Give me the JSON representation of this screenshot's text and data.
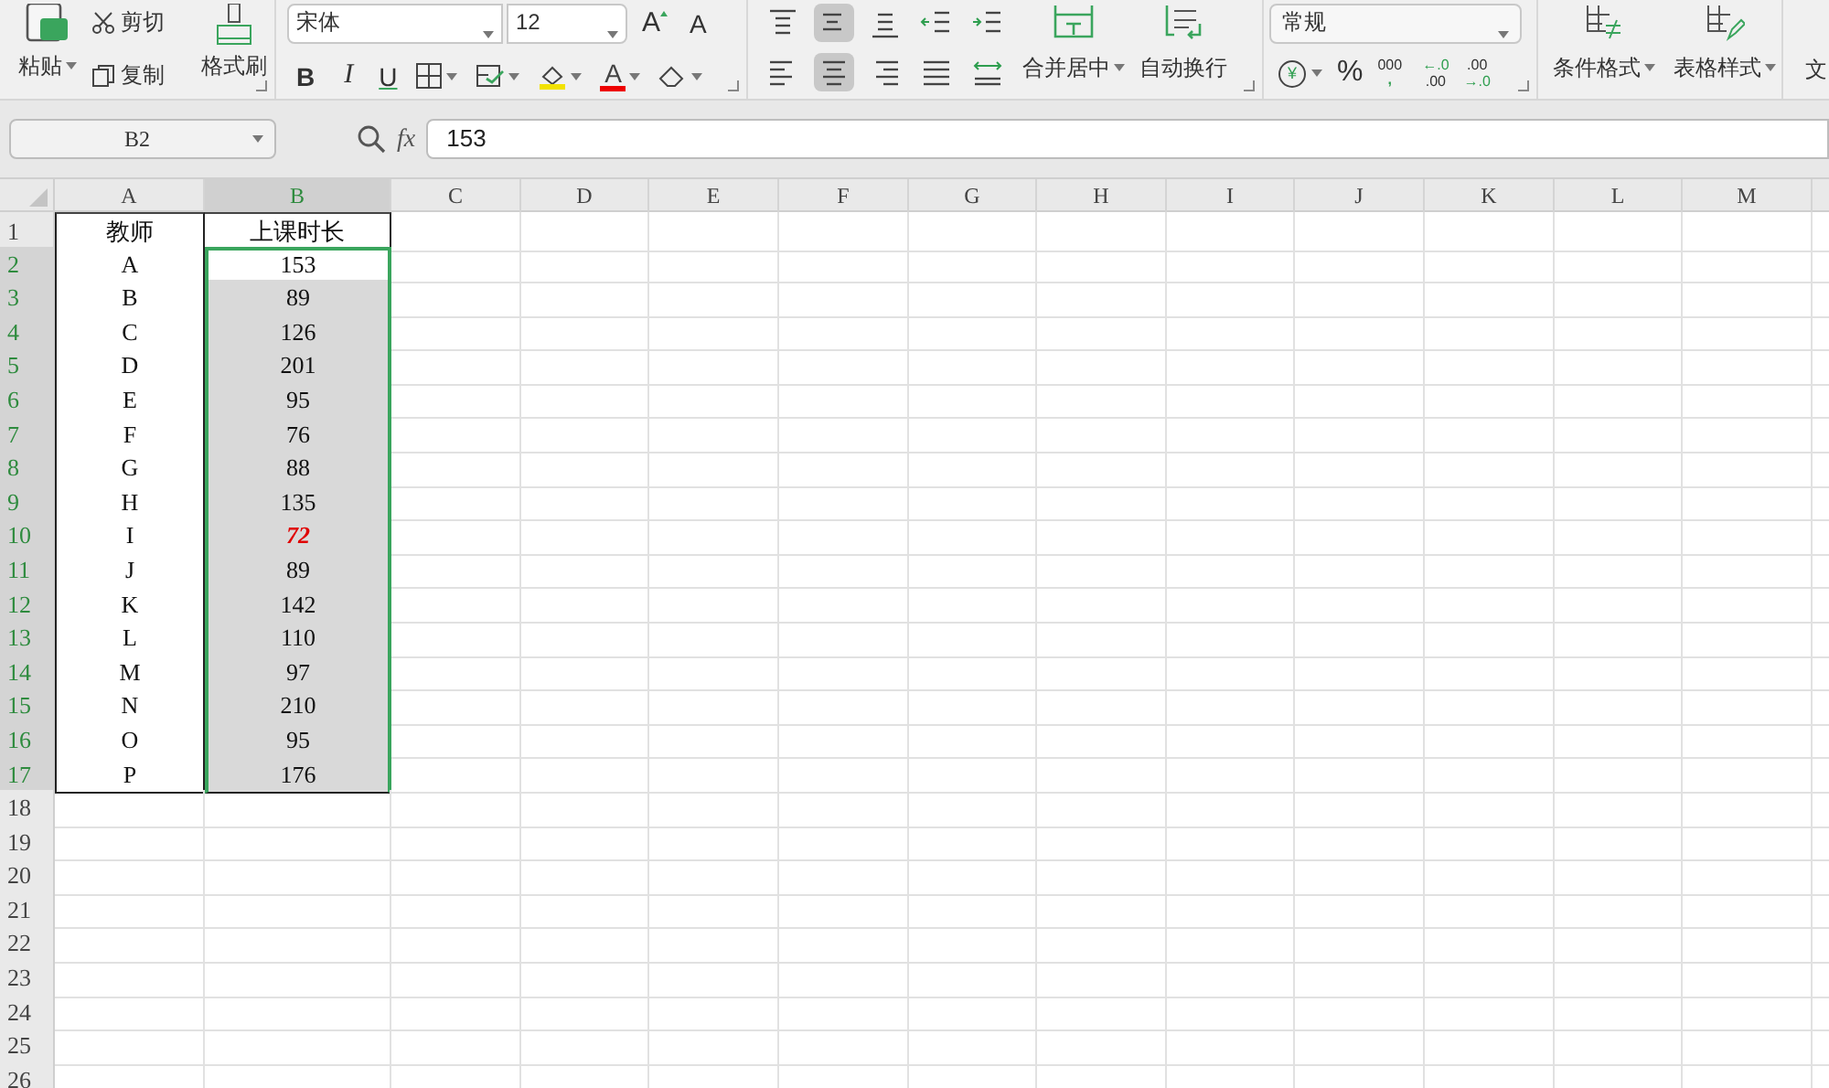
{
  "toolbar": {
    "clipboard": {
      "paste": "粘贴",
      "cut": "剪切",
      "copy": "复制",
      "format_painter": "格式刷"
    },
    "font": {
      "family": "宋体",
      "size": "12",
      "grow": "A",
      "shrink": "A",
      "bold": "B",
      "italic": "I",
      "underline": "U",
      "font_color": "A"
    },
    "align_top_row": [
      {
        "kind": "top",
        "selected": false
      },
      {
        "kind": "middle",
        "selected": true
      },
      {
        "kind": "bottom",
        "selected": false
      },
      {
        "kind": "outdent",
        "selected": false
      },
      {
        "kind": "indent",
        "selected": false
      }
    ],
    "align_bottom_row": [
      {
        "kind": "left",
        "selected": false
      },
      {
        "kind": "center",
        "selected": true
      },
      {
        "kind": "right",
        "selected": false
      },
      {
        "kind": "justify",
        "selected": false
      },
      {
        "kind": "distributed",
        "selected": false
      }
    ],
    "merge": "合并居中",
    "wrap": "自动换行",
    "number": {
      "format": "常规",
      "currency": "¥",
      "percent": "%",
      "thousands": [
        "000",
        ","
      ],
      "increase_decimal": [
        "←.0",
        ".00"
      ],
      "decrease_decimal": [
        ".00",
        "→.0"
      ]
    },
    "styles": [
      "条件格式",
      "表格样式"
    ],
    "cut_off": "文"
  },
  "formula_bar": {
    "name_box": "B2",
    "fx": "fx",
    "formula": "153"
  },
  "sheet": {
    "columns": [
      {
        "label": "A",
        "selected": false
      },
      {
        "label": "B",
        "selected": true
      },
      {
        "label": "C",
        "selected": false
      },
      {
        "label": "D",
        "selected": false
      },
      {
        "label": "E",
        "selected": false
      },
      {
        "label": "F",
        "selected": false
      },
      {
        "label": "G",
        "selected": false
      },
      {
        "label": "H",
        "selected": false
      },
      {
        "label": "I",
        "selected": false
      },
      {
        "label": "J",
        "selected": false
      },
      {
        "label": "K",
        "selected": false
      },
      {
        "label": "L",
        "selected": false
      },
      {
        "label": "M",
        "selected": false
      }
    ],
    "rows": [
      {
        "label": "1",
        "selected": false,
        "cells": [
          {
            "text": "教师",
            "kind": "normal",
            "selected": false,
            "active": false
          },
          {
            "text": "上课时长",
            "kind": "normal",
            "selected": false,
            "active": false
          }
        ]
      },
      {
        "label": "2",
        "selected": true,
        "cells": [
          {
            "text": "A",
            "kind": "normal",
            "selected": false,
            "active": false
          },
          {
            "text": "153",
            "kind": "normal",
            "selected": true,
            "active": true
          }
        ]
      },
      {
        "label": "3",
        "selected": true,
        "cells": [
          {
            "text": "B",
            "kind": "normal",
            "selected": false,
            "active": false
          },
          {
            "text": "89",
            "kind": "normal",
            "selected": true,
            "active": false
          }
        ]
      },
      {
        "label": "4",
        "selected": true,
        "cells": [
          {
            "text": "C",
            "kind": "normal",
            "selected": false,
            "active": false
          },
          {
            "text": "126",
            "kind": "normal",
            "selected": true,
            "active": false
          }
        ]
      },
      {
        "label": "5",
        "selected": true,
        "cells": [
          {
            "text": "D",
            "kind": "normal",
            "selected": false,
            "active": false
          },
          {
            "text": "201",
            "kind": "normal",
            "selected": true,
            "active": false
          }
        ]
      },
      {
        "label": "6",
        "selected": true,
        "cells": [
          {
            "text": "E",
            "kind": "normal",
            "selected": false,
            "active": false
          },
          {
            "text": "95",
            "kind": "normal",
            "selected": true,
            "active": false
          }
        ]
      },
      {
        "label": "7",
        "selected": true,
        "cells": [
          {
            "text": "F",
            "kind": "normal",
            "selected": false,
            "active": false
          },
          {
            "text": "76",
            "kind": "normal",
            "selected": true,
            "active": false
          }
        ]
      },
      {
        "label": "8",
        "selected": true,
        "cells": [
          {
            "text": "G",
            "kind": "normal",
            "selected": false,
            "active": false
          },
          {
            "text": "88",
            "kind": "normal",
            "selected": true,
            "active": false
          }
        ]
      },
      {
        "label": "9",
        "selected": true,
        "cells": [
          {
            "text": "H",
            "kind": "normal",
            "selected": false,
            "active": false
          },
          {
            "text": "135",
            "kind": "normal",
            "selected": true,
            "active": false
          }
        ]
      },
      {
        "label": "10",
        "selected": true,
        "cells": [
          {
            "text": "I",
            "kind": "normal",
            "selected": false,
            "active": false
          },
          {
            "text": "72",
            "kind": "flagged",
            "selected": true,
            "active": false
          }
        ]
      },
      {
        "label": "11",
        "selected": true,
        "cells": [
          {
            "text": "J",
            "kind": "normal",
            "selected": false,
            "active": false
          },
          {
            "text": "89",
            "kind": "normal",
            "selected": true,
            "active": false
          }
        ]
      },
      {
        "label": "12",
        "selected": true,
        "cells": [
          {
            "text": "K",
            "kind": "normal",
            "selected": false,
            "active": false
          },
          {
            "text": "142",
            "kind": "normal",
            "selected": true,
            "active": false
          }
        ]
      },
      {
        "label": "13",
        "selected": true,
        "cells": [
          {
            "text": "L",
            "kind": "normal",
            "selected": false,
            "active": false
          },
          {
            "text": "110",
            "kind": "normal",
            "selected": true,
            "active": false
          }
        ]
      },
      {
        "label": "14",
        "selected": true,
        "cells": [
          {
            "text": "M",
            "kind": "normal",
            "selected": false,
            "active": false
          },
          {
            "text": "97",
            "kind": "normal",
            "selected": true,
            "active": false
          }
        ]
      },
      {
        "label": "15",
        "selected": true,
        "cells": [
          {
            "text": "N",
            "kind": "normal",
            "selected": false,
            "active": false
          },
          {
            "text": "210",
            "kind": "normal",
            "selected": true,
            "active": false
          }
        ]
      },
      {
        "label": "16",
        "selected": true,
        "cells": [
          {
            "text": "O",
            "kind": "normal",
            "selected": false,
            "active": false
          },
          {
            "text": "95",
            "kind": "normal",
            "selected": true,
            "active": false
          }
        ]
      },
      {
        "label": "17",
        "selected": true,
        "cells": [
          {
            "text": "P",
            "kind": "normal",
            "selected": false,
            "active": false
          },
          {
            "text": "176",
            "kind": "normal",
            "selected": true,
            "active": false
          }
        ]
      },
      {
        "label": "18",
        "selected": false,
        "cells": []
      },
      {
        "label": "19",
        "selected": false,
        "cells": []
      },
      {
        "label": "20",
        "selected": false,
        "cells": []
      },
      {
        "label": "21",
        "selected": false,
        "cells": []
      },
      {
        "label": "22",
        "selected": false,
        "cells": []
      },
      {
        "label": "23",
        "selected": false,
        "cells": []
      },
      {
        "label": "24",
        "selected": false,
        "cells": []
      },
      {
        "label": "25",
        "selected": false,
        "cells": []
      },
      {
        "label": "26",
        "selected": false,
        "cells": []
      }
    ]
  }
}
